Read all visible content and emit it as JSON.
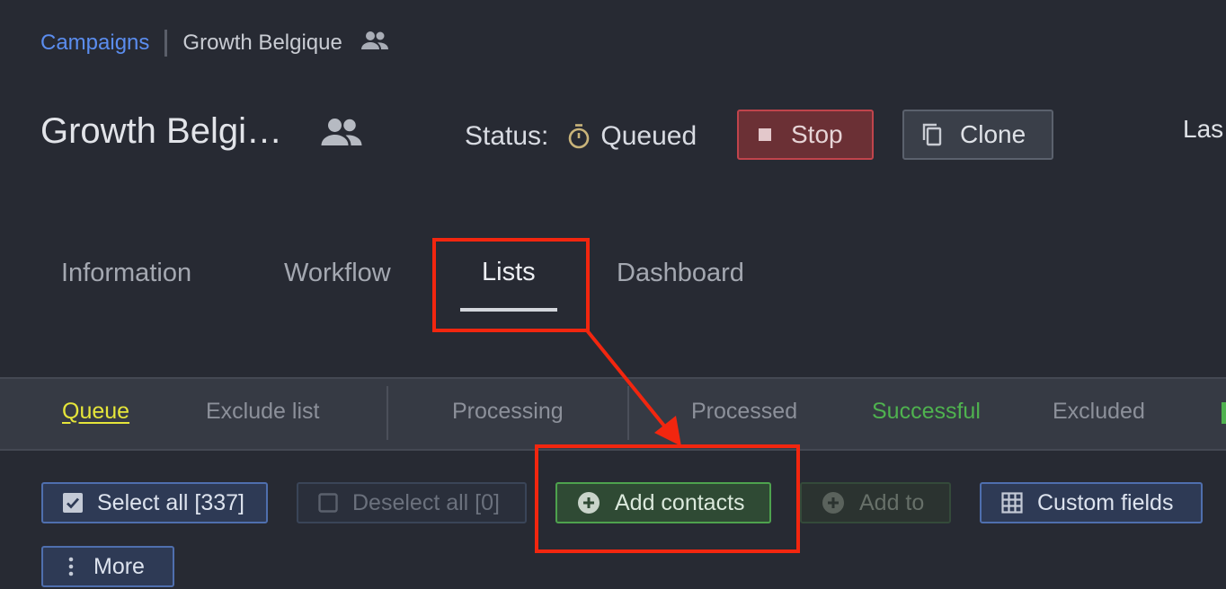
{
  "breadcrumb": {
    "link": "Campaigns",
    "current": "Growth Belgique"
  },
  "header": {
    "title": "Growth Belgi…",
    "status_label": "Status:",
    "status_value": "Queued",
    "stop_label": "Stop",
    "clone_label": "Clone",
    "last_label_partial": "Las"
  },
  "tabs": [
    {
      "label": "Information"
    },
    {
      "label": "Workflow"
    },
    {
      "label": "Lists",
      "active": true
    },
    {
      "label": "Dashboard"
    }
  ],
  "subtabs": [
    {
      "label": "Queue",
      "active": true,
      "color": "#e5e53a"
    },
    {
      "label": "Exclude list"
    },
    {
      "label": "Processing"
    },
    {
      "label": "Processed"
    },
    {
      "label": "Successful",
      "color": "#4fb24f"
    },
    {
      "label": "Excluded"
    }
  ],
  "toolbar": {
    "select_all": "Select all [337]",
    "deselect_all": "Deselect all [0]",
    "add_contacts": "Add contacts",
    "add_to": "Add to",
    "custom_fields": "Custom fields",
    "more": "More"
  },
  "icons": {
    "breadcrumb": "people-icon",
    "title": "people-icon",
    "status": "timer-icon",
    "stop": "stop-square-icon",
    "clone": "copy-icon",
    "select_all": "checkbox-checked-icon",
    "deselect_all": "checkbox-empty-icon",
    "add_contacts": "plus-circle-icon",
    "add_to": "plus-circle-icon",
    "custom_fields": "grid-icon",
    "more": "vertical-dots-icon"
  },
  "colors": {
    "background": "#272a33",
    "link": "#5b8def",
    "annotation": "#f2260f",
    "stop_border": "#c0444c",
    "success": "#4fb24f",
    "primary_border": "#4f6fae"
  }
}
